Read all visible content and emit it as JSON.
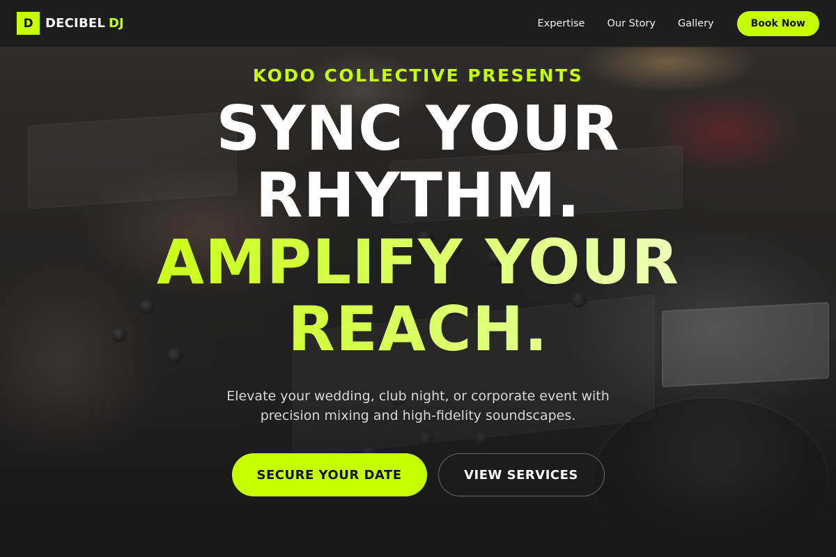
{
  "navbar": {
    "logo_mark": "D",
    "brand_name": "DECIBEL",
    "brand_accent": "DJ",
    "links": [
      {
        "label": "Expertise"
      },
      {
        "label": "Our Story"
      },
      {
        "label": "Gallery"
      }
    ],
    "cta_label": "Book Now"
  },
  "hero": {
    "eyebrow": "KODO COLLECTIVE PRESENTS",
    "headline_line1": "SYNC YOUR RHYTHM.",
    "headline_line2": "AMPLIFY YOUR REACH.",
    "subtitle": "Elevate your wedding, club night, or corporate event with precision mixing and high-fidelity soundscapes.",
    "primary_cta": "SECURE YOUR DATE",
    "secondary_cta": "VIEW SERVICES",
    "background_image": "dj-mixer-photo"
  },
  "colors": {
    "accent": "#c6ff00",
    "background": "#1a1a1a",
    "text": "#ffffff"
  }
}
